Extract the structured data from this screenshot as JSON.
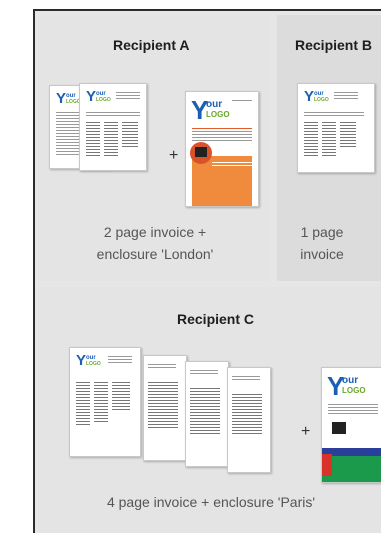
{
  "recipient_a": {
    "title": "Recipient A",
    "plus": "+",
    "caption_line1": "2 page invoice +",
    "caption_line2": "enclosure 'London'"
  },
  "recipient_b": {
    "title": "Recipient B",
    "caption_line1": "1 page",
    "caption_line2": "invoice"
  },
  "recipient_c": {
    "title": "Recipient C",
    "plus": "+",
    "caption": "4 page invoice + enclosure 'Paris'"
  },
  "logo": {
    "big_letter": "Y",
    "our": "our",
    "logo": "LOGO"
  },
  "colors": {
    "brand_blue": "#1a5fb4",
    "brand_green": "#6aa82a",
    "london_orange": "#f08a3c",
    "paris_green": "#1a9a4a",
    "paris_blue": "#2a3f9a"
  }
}
